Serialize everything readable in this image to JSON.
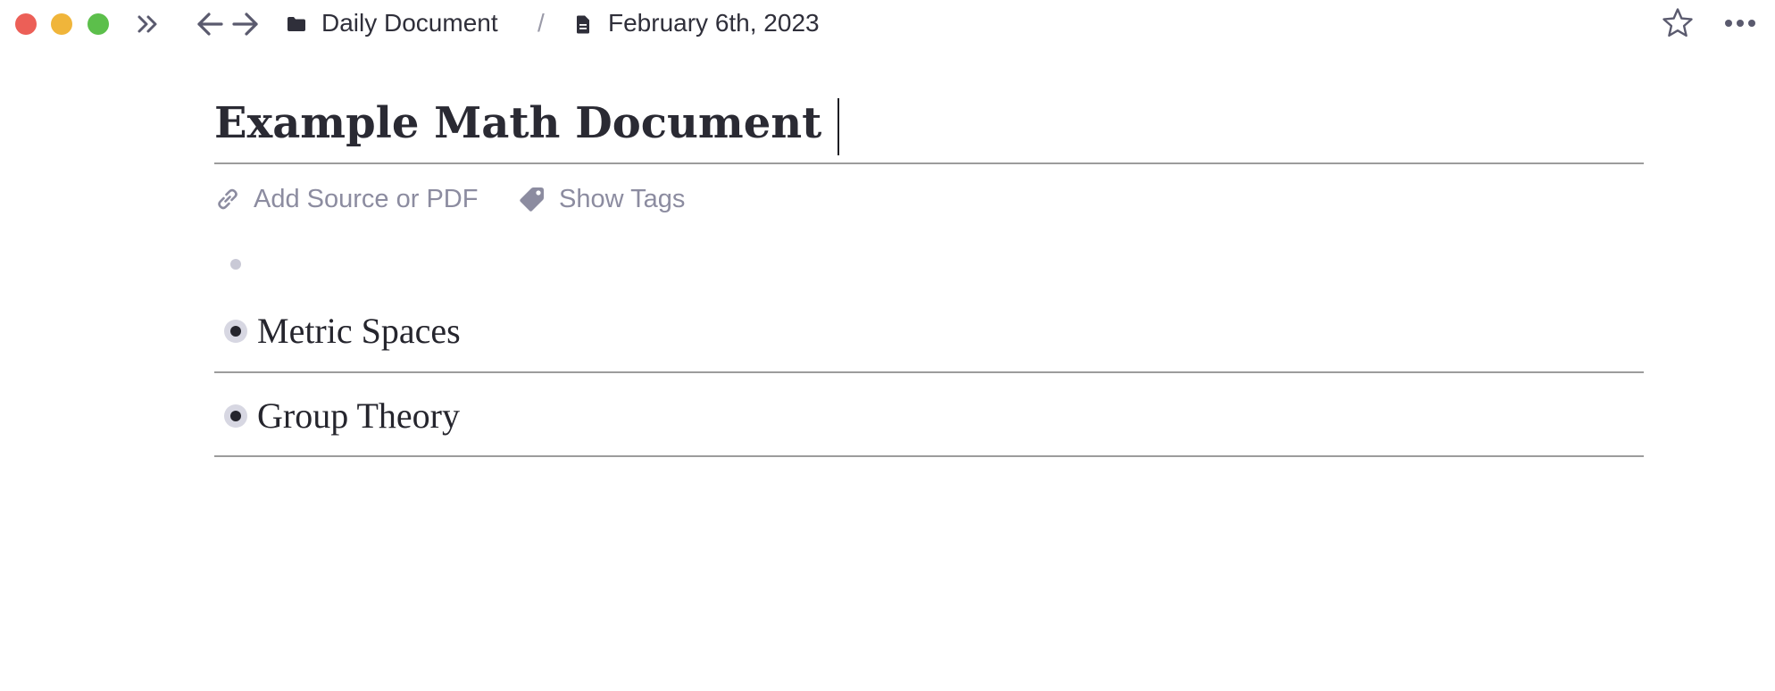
{
  "window": {
    "controls": [
      "close",
      "minimize",
      "zoom"
    ],
    "control_colors": {
      "close": "#ec5f57",
      "minimize": "#f0b53a",
      "zoom": "#5cbf4b"
    }
  },
  "toolbar": {
    "sidebar_toggle_icon": "double-chevron-right-icon",
    "back_icon": "arrow-left-icon",
    "forward_icon": "arrow-right-icon",
    "breadcrumb": {
      "folder_icon": "folder-icon",
      "folder_label": "Daily Document",
      "separator": "/",
      "page_icon": "document-icon",
      "page_label": "February 6th, 2023"
    },
    "favorite_icon": "star-icon",
    "more_icon": "more-horizontal-icon"
  },
  "document": {
    "title": "Example Math Document",
    "meta": {
      "add_source_icon": "link-icon",
      "add_source_label": "Add Source or PDF",
      "tags_icon": "tag-icon",
      "tags_label": "Show Tags"
    },
    "blocks": [
      {
        "label": "Metric Spaces"
      },
      {
        "label": "Group Theory"
      }
    ]
  },
  "colors": {
    "text": "#2b2b35",
    "muted": "#8c8ca0",
    "rule": "#9c9c9c",
    "bullet_ring": "#d7d7e2"
  }
}
